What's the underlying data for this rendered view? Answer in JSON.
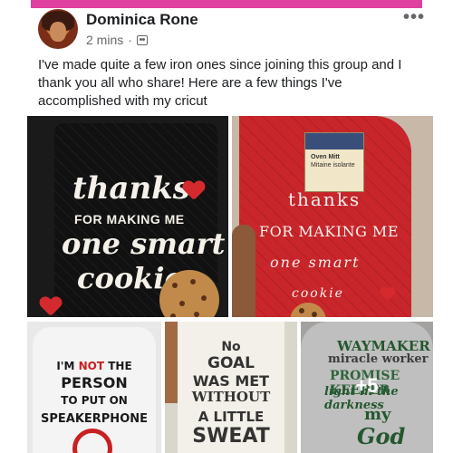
{
  "post": {
    "author": "Dominica Rone",
    "time": "2 mins",
    "separator": "·",
    "more": "•••",
    "text": "I've made quite a few iron ones since joining this group and I thank you all who share! Here are a few things I've accomplished with my cricut"
  },
  "photos": {
    "p1": {
      "line1": "thanks",
      "line2": "FOR MAKING ME",
      "line3": "one smart",
      "line4": "cookie"
    },
    "p2": {
      "tag_line1": "Oven Mitt",
      "tag_line2": "Mitaine isolante",
      "line1": "thanks",
      "line2": "FOR MAKING ME",
      "line3": "one smart",
      "line4": "cookie"
    },
    "p3": {
      "line1_a": "I'M ",
      "line1_b": "NOT",
      "line1_c": " THE",
      "line2": "PERSON",
      "line3": "TO PUT ON",
      "line4": "SPEAKERPHONE"
    },
    "p4": {
      "line1": "No",
      "line2": "GOAL",
      "line3": "WAS MET",
      "line4": "WITHOUT",
      "line5": "A LITTLE",
      "line6": "SWEAT"
    },
    "p5": {
      "line1": "WAYMAKER",
      "line2": "miracle worker",
      "line3": "PROMISE KEEPER",
      "line4": "light in the darkness",
      "line5": "my",
      "line6": "God",
      "more_count": "+5"
    }
  },
  "colors": {
    "accent": "#e040a0",
    "heart": "#d42a2e",
    "mitt_red": "#c8262a",
    "green": "#2e6b3a"
  }
}
